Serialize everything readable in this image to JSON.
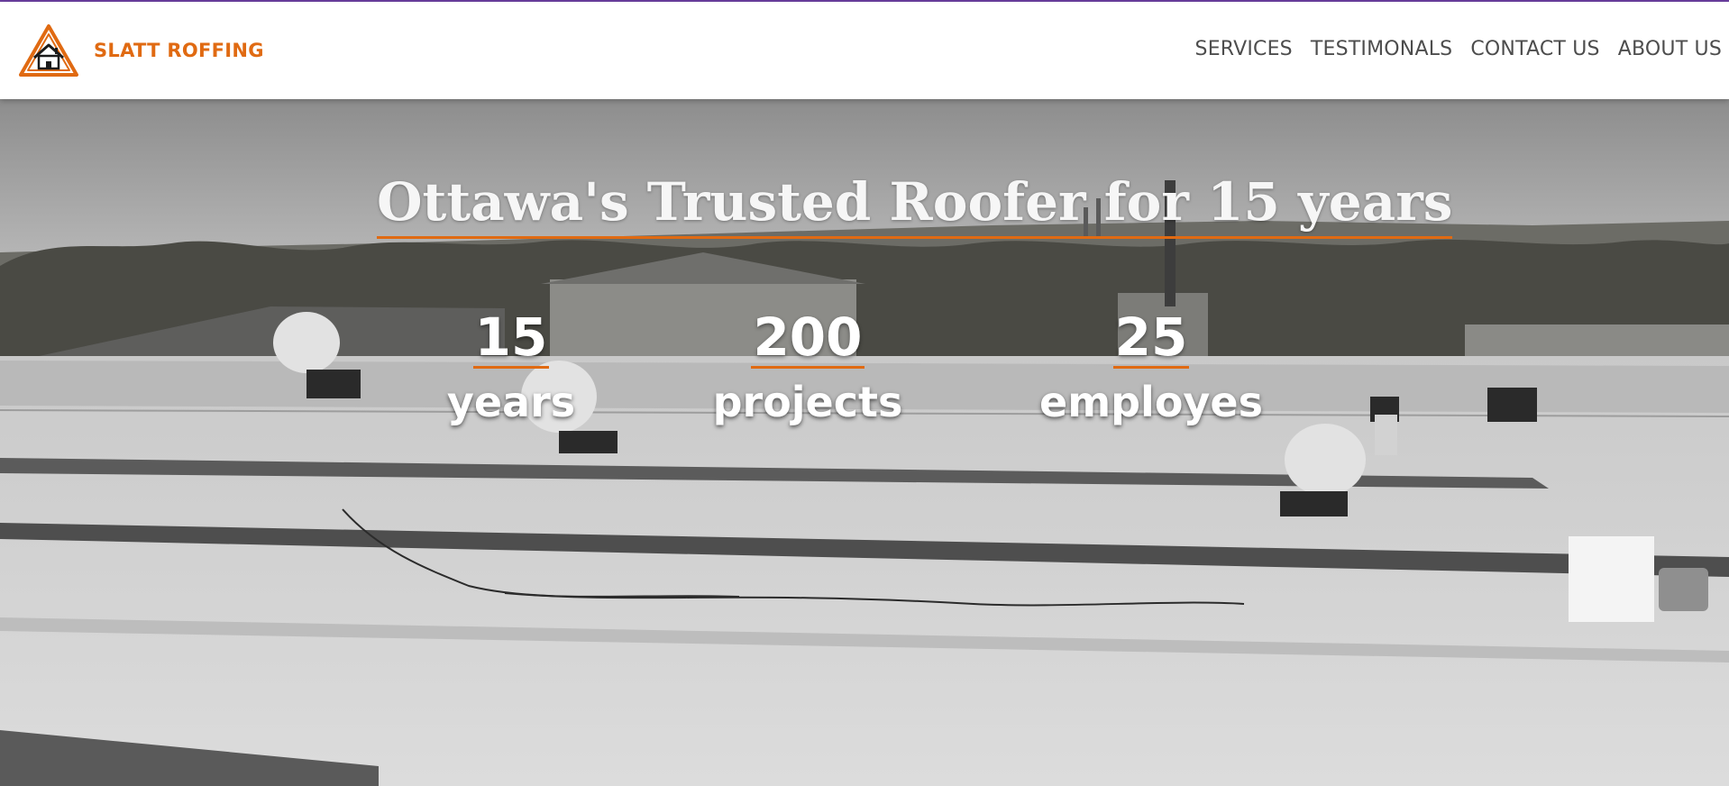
{
  "brand": {
    "name": "SLATT ROFFING",
    "logo_icon": "house-triangle-icon",
    "accent_color": "#e06a12"
  },
  "nav": {
    "items": [
      "SERVICES",
      "TESTIMONALS",
      "CONTACT US",
      "ABOUT US"
    ]
  },
  "hero": {
    "headline": "Ottawa's Trusted Roofer for 15 years",
    "stats": [
      {
        "number": "15",
        "label": "years"
      },
      {
        "number": "200",
        "label": "projects"
      },
      {
        "number": "25",
        "label": "employes"
      }
    ]
  }
}
